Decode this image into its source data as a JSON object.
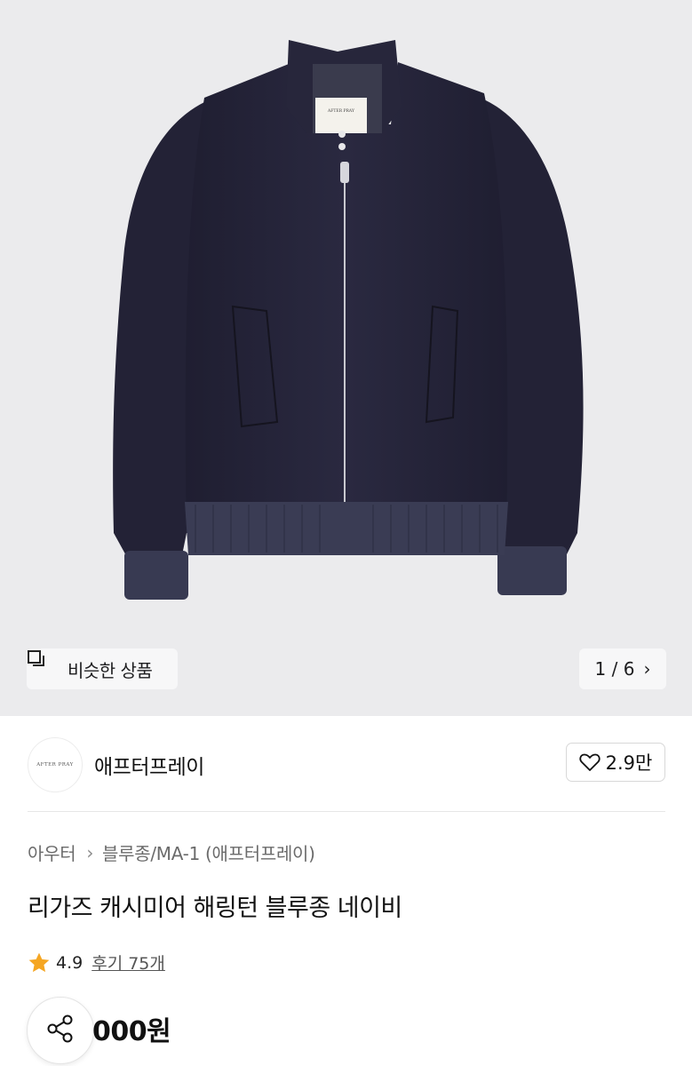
{
  "gallery": {
    "similar_label": "비슷한 상품",
    "pager_text": "1 / 6",
    "product_logo_text": "AFTER PRAY"
  },
  "brand": {
    "logo_text": "AFTER PRAY",
    "name": "애프터프레이",
    "like_count": "2.9만"
  },
  "breadcrumb": {
    "category": "아우터",
    "subcategory": "블루종/MA-1 (애프터프레이)"
  },
  "product": {
    "title": "리가즈 캐시미어 해링턴 블루종 네이비",
    "rating": "4.9",
    "reviews": "후기 75개",
    "price_visible": "000원"
  },
  "colors": {
    "star": "#f5a623",
    "jacket": "#25243a",
    "background": "#ebebed"
  }
}
